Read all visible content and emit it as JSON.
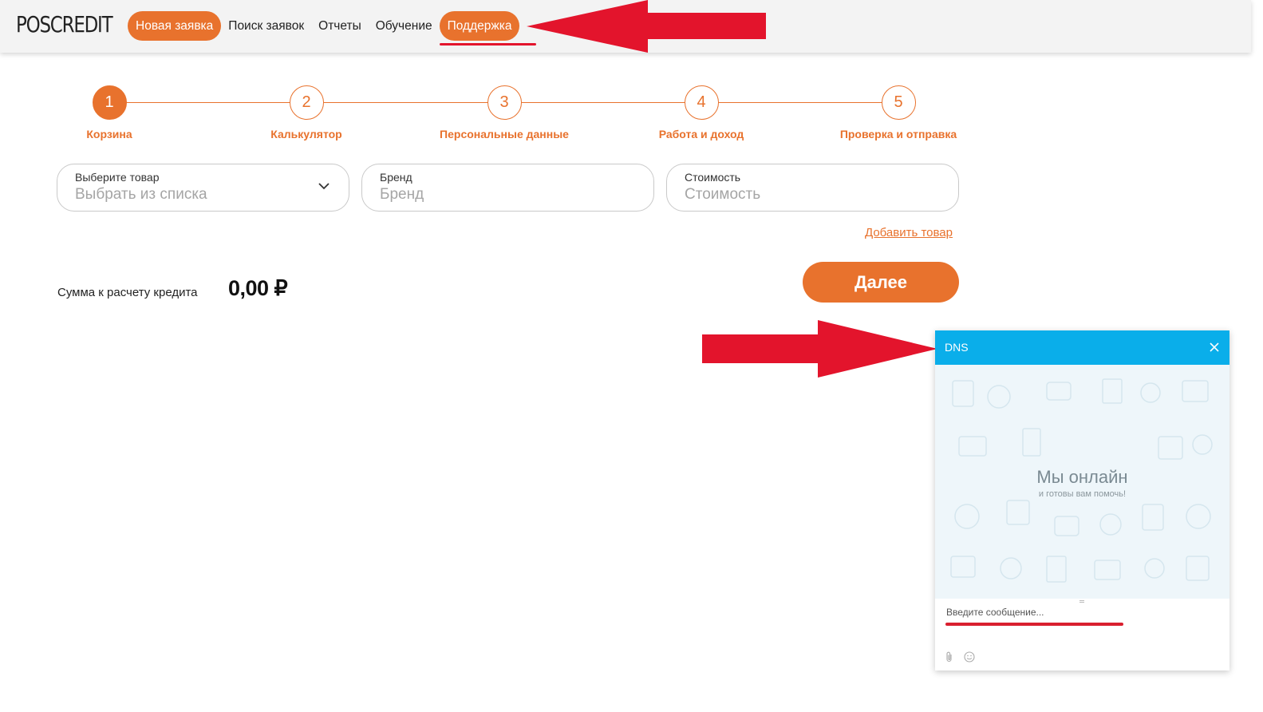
{
  "header": {
    "logo": "POSCREDIT",
    "nav": [
      {
        "label": "Новая заявка",
        "active": true
      },
      {
        "label": "Поиск заявок",
        "active": false
      },
      {
        "label": "Отчеты",
        "active": false
      },
      {
        "label": "Обучение",
        "active": false
      },
      {
        "label": "Поддержка",
        "active": true
      }
    ],
    "accent_color": "#e8722d"
  },
  "stepper": {
    "steps": [
      {
        "number": "1",
        "label": "Корзина",
        "active": true
      },
      {
        "number": "2",
        "label": "Калькулятор",
        "active": false
      },
      {
        "number": "3",
        "label": "Персональные данные",
        "active": false
      },
      {
        "number": "4",
        "label": "Работа и доход",
        "active": false
      },
      {
        "number": "5",
        "label": "Проверка и отправка",
        "active": false
      }
    ]
  },
  "form": {
    "product": {
      "label": "Выберите товар",
      "placeholder": "Выбрать из списка",
      "icon": "chevron-down-icon"
    },
    "brand": {
      "label": "Бренд",
      "placeholder": "Бренд"
    },
    "price": {
      "label": "Стоимость",
      "placeholder": "Стоимость"
    },
    "add_item": "Добавить товар"
  },
  "summary": {
    "label": "Сумма к расчету кредита",
    "value": "0,00 ₽"
  },
  "next_button": "Далее",
  "chat": {
    "title": "DNS",
    "online_title": "Мы онлайн",
    "online_subtitle": "и готовы вам помочь!",
    "input_placeholder": "Введите сообщение...",
    "header_color": "#0aaeea",
    "icons": [
      "close-icon",
      "paperclip-icon",
      "emoji-icon"
    ]
  },
  "annotations": {
    "arrow_color": "#e3142c"
  }
}
